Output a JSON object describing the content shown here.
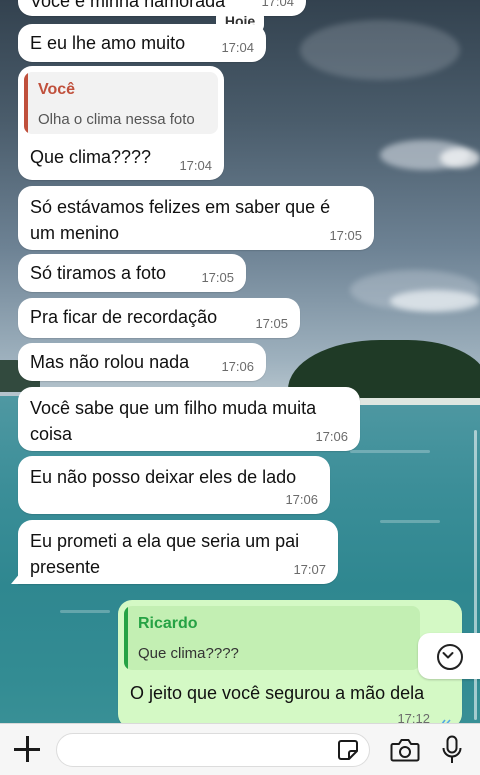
{
  "date_separator": "Hoje",
  "messages": [
    {
      "dir": "in",
      "text": "Você é minha namorada",
      "time": "17:04"
    },
    {
      "dir": "in",
      "text": "E eu lhe amo muito",
      "time": "17:04"
    },
    {
      "dir": "in",
      "quote": {
        "author": "Você",
        "text": "Olha o clima nessa foto"
      },
      "text": "Que clima????",
      "time": "17:04"
    },
    {
      "dir": "in",
      "text": "Só estávamos felizes em saber que é\num menino",
      "time": "17:05"
    },
    {
      "dir": "in",
      "text": "Só tiramos a foto",
      "time": "17:05"
    },
    {
      "dir": "in",
      "text": "Pra ficar de recordação",
      "time": "17:05"
    },
    {
      "dir": "in",
      "text": "Mas não rolou nada",
      "time": "17:06"
    },
    {
      "dir": "in",
      "text": "Você sabe que um filho muda muita\ncoisa",
      "time": "17:06"
    },
    {
      "dir": "in",
      "text": "Eu não posso deixar eles de lado",
      "time": "17:06"
    },
    {
      "dir": "in",
      "text": "Eu prometi a ela que seria um pai\npresente",
      "time": "17:07"
    },
    {
      "dir": "out",
      "quote": {
        "author": "Ricardo",
        "text": "Que clima????"
      },
      "text": "O jeito que você segurou a mão dela",
      "time": "17:12",
      "status": "read"
    }
  ],
  "composer": {
    "placeholder": ""
  },
  "icons": {
    "attach": "plus-icon",
    "sticker": "sticker-icon",
    "camera": "camera-icon",
    "mic": "microphone-icon",
    "scroll": "chevron-down-icon",
    "read": "double-check-icon"
  },
  "colors": {
    "incoming_bubble": "#ffffff",
    "outgoing_bubble": "#d4f9c5",
    "quote_you": "#c0503c",
    "quote_ricardo": "#25a244",
    "read_ticks": "#53a6e6"
  }
}
